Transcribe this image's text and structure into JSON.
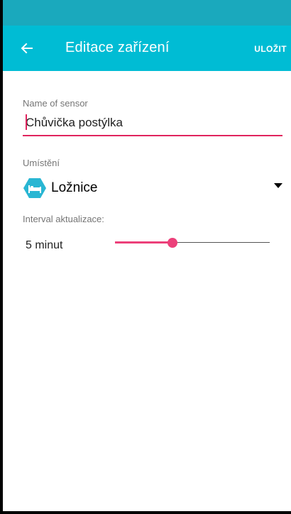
{
  "colors": {
    "status_bar": "#1aa9bd",
    "app_bar": "#00bcd4",
    "accent": "#ec407a",
    "input_underline": "#e0245e"
  },
  "app_bar": {
    "back_icon": "arrow-left-icon",
    "title": "Editace zařízení",
    "save_label": "ULOŽIT"
  },
  "sensor": {
    "label": "Name of sensor",
    "value": "Chůvička postýlka"
  },
  "location": {
    "label": "Umístění",
    "icon": "bed-hexagon-icon",
    "selected": "Ložnice"
  },
  "interval": {
    "label": "Interval aktualizace:",
    "value_text": "5 minut",
    "slider_fraction": 0.37
  }
}
